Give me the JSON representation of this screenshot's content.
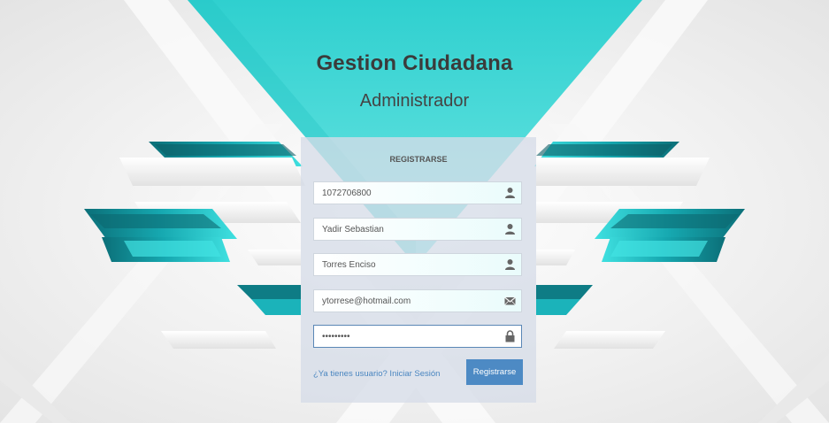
{
  "header": {
    "title": "Gestion Ciudadana",
    "subtitle": "Administrador"
  },
  "form": {
    "heading": "REGISTRARSE",
    "fields": [
      {
        "name": "document",
        "value": "1072706800",
        "icon": "user-icon"
      },
      {
        "name": "first_names",
        "value": "Yadir Sebastian",
        "icon": "user-icon"
      },
      {
        "name": "last_names",
        "value": "Torres Enciso",
        "icon": "user-icon"
      },
      {
        "name": "email",
        "value": "ytorrese@hotmail.com",
        "icon": "envelope-icon"
      },
      {
        "name": "password",
        "value": "•••••••••",
        "icon": "lock-icon"
      }
    ],
    "login_link": "¿Ya tienes usuario? Iniciar Sesión",
    "submit_label": "Registrarse"
  },
  "colors": {
    "accent_teal": "#3cd6d6",
    "dark_teal": "#0b6f78",
    "button": "#4d8ac4",
    "link": "#4a86c0"
  }
}
